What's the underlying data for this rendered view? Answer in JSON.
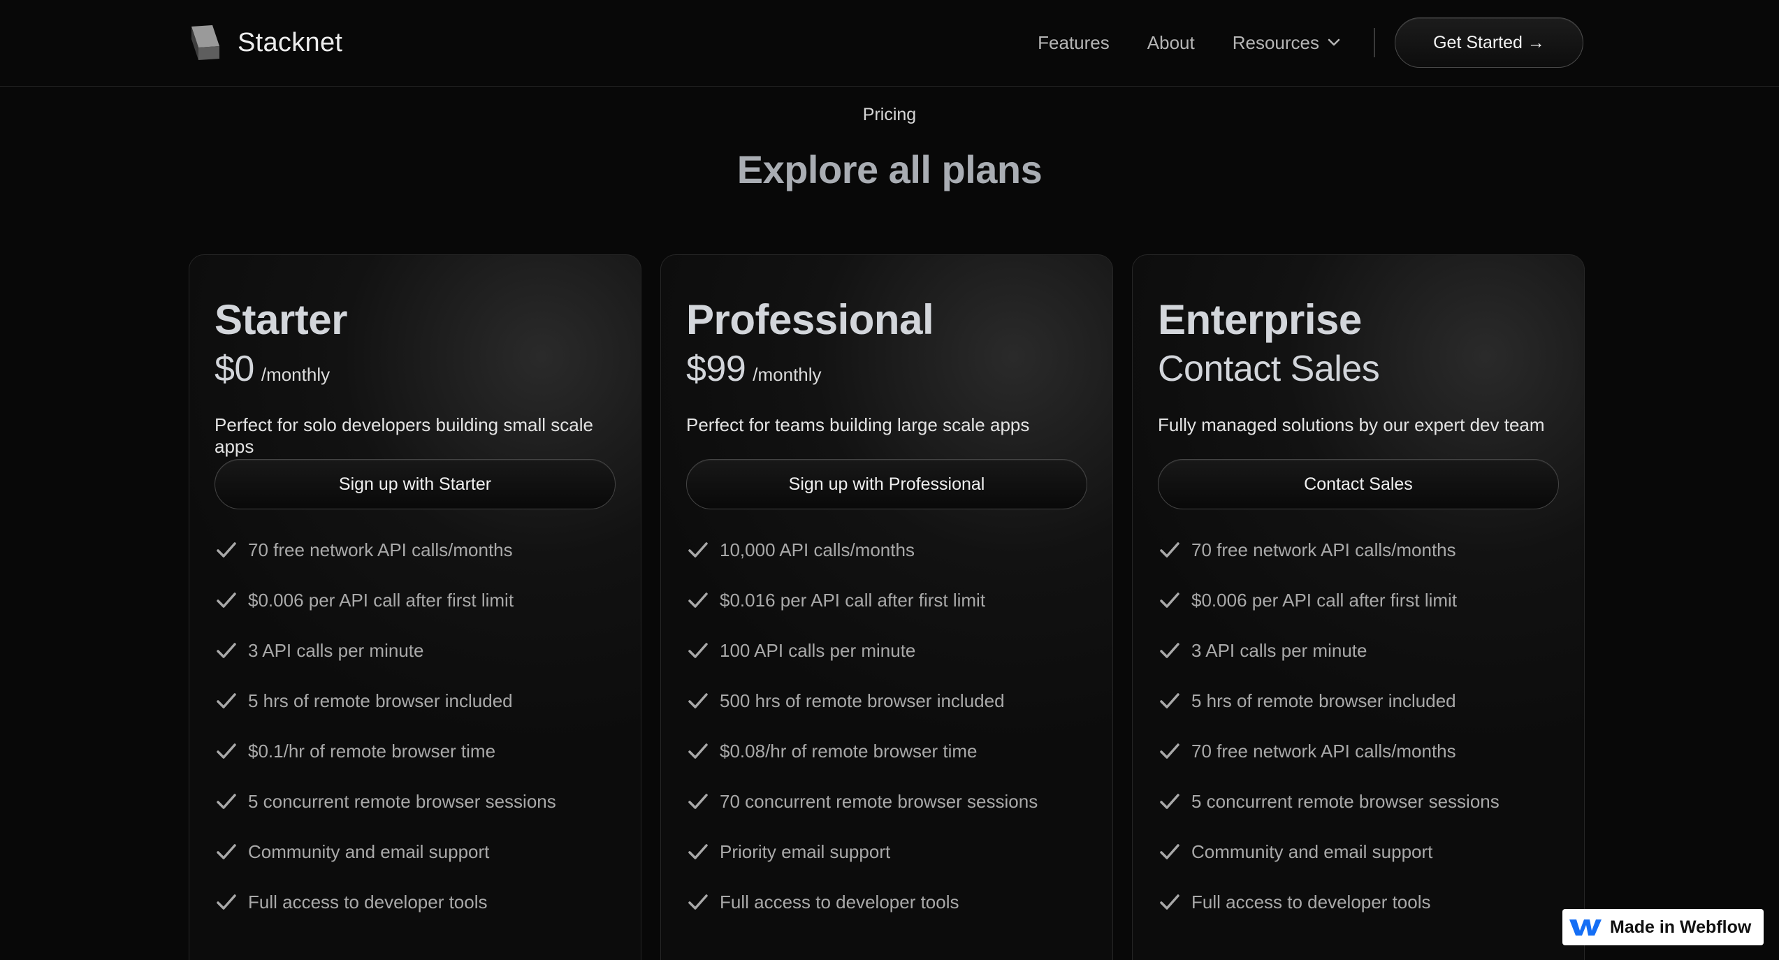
{
  "brand": {
    "name": "Stacknet"
  },
  "nav": {
    "links": [
      "Features",
      "About",
      "Resources"
    ],
    "cta": "Get Started →"
  },
  "hero": {
    "eyebrow": "Pricing",
    "title": "Explore all plans"
  },
  "plans": [
    {
      "name": "Starter",
      "price": "$0",
      "period": "/monthly",
      "description": "Perfect for solo developers building small scale apps",
      "button": "Sign up with Starter",
      "features": [
        "70 free network API calls/months",
        "$0.006 per API call after first limit",
        "3 API calls per minute",
        "5 hrs of remote browser included",
        "$0.1/hr of remote browser time",
        "5 concurrent remote browser sessions",
        "Community and email support",
        "Full access to developer tools"
      ]
    },
    {
      "name": "Professional",
      "price": "$99",
      "period": "/monthly",
      "description": "Perfect for teams building large scale apps",
      "button": "Sign up with Professional",
      "features": [
        "10,000 API calls/months",
        "$0.016 per API call after first limit",
        "100 API calls per minute",
        "500 hrs of remote browser included",
        "$0.08/hr of remote browser time",
        "70 concurrent remote browser sessions",
        "Priority email support",
        "Full access to developer tools"
      ]
    },
    {
      "name": "Enterprise",
      "price": "Contact Sales",
      "period": "",
      "description": "Fully managed solutions by our expert dev team",
      "button": "Contact Sales",
      "features": [
        "70 free network API calls/months",
        "$0.006 per API call after first limit",
        "3 API calls per minute",
        "5 hrs of remote browser included",
        "70 free network API calls/months",
        "5 concurrent remote browser sessions",
        "Community and email support",
        "Full access to developer tools"
      ]
    }
  ],
  "badge": {
    "label": "Made in Webflow"
  },
  "colors": {
    "background": "#080808",
    "card": "#0c0c0c",
    "heading": "#d3d6db",
    "muted_text": "#a9a9a9",
    "check": "#a9a9a9",
    "webflow_blue": "#146ef5"
  }
}
